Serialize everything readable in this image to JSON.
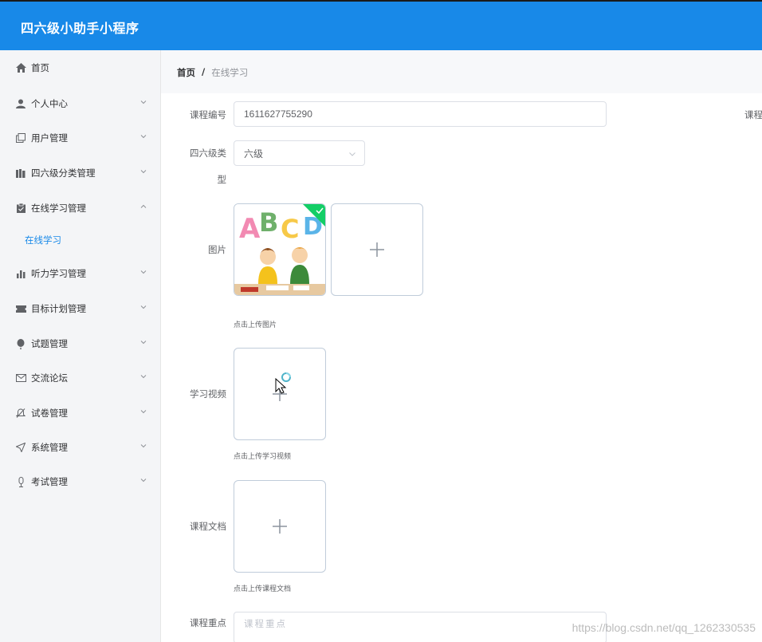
{
  "app": {
    "title": "四六级小助手小程序"
  },
  "sidebar": {
    "items": [
      {
        "label": "首页",
        "icon": "home-icon"
      },
      {
        "label": "个人中心",
        "icon": "user-icon"
      },
      {
        "label": "用户管理",
        "icon": "copy-icon"
      },
      {
        "label": "四六级分类管理",
        "icon": "books-icon"
      },
      {
        "label": "在线学习管理",
        "icon": "clipboard-icon"
      },
      {
        "label": "听力学习管理",
        "icon": "bar-chart-icon"
      },
      {
        "label": "目标计划管理",
        "icon": "ticket-icon"
      },
      {
        "label": "试题管理",
        "icon": "balloon-icon"
      },
      {
        "label": "交流论坛",
        "icon": "mail-icon"
      },
      {
        "label": "试卷管理",
        "icon": "bell-off-icon"
      },
      {
        "label": "系统管理",
        "icon": "send-icon"
      },
      {
        "label": "考试管理",
        "icon": "mic-icon"
      }
    ],
    "subitem": {
      "label": "在线学习"
    }
  },
  "breadcrumb": {
    "home": "首页",
    "separator": "/",
    "current": "在线学习"
  },
  "form": {
    "course_no": {
      "label": "课程编号",
      "value": "1611627755290"
    },
    "course_name_partial_label": "课程",
    "level_type": {
      "label_line1": "四六级类",
      "label_line2": "型",
      "value": "六级"
    },
    "picture": {
      "label": "图片",
      "tip": "点击上传图片"
    },
    "video": {
      "label": "学习视频",
      "tip": "点击上传学习视频"
    },
    "document": {
      "label": "课程文档",
      "tip": "点击上传课程文档"
    },
    "key_points": {
      "label": "课程重点",
      "placeholder": "课程重点"
    }
  },
  "watermark": "https://blog.csdn.net/qq_1262330535",
  "colors": {
    "primary": "#1889e8",
    "sidebar_bg": "#f4f5f7",
    "border": "#dcdfe6"
  }
}
